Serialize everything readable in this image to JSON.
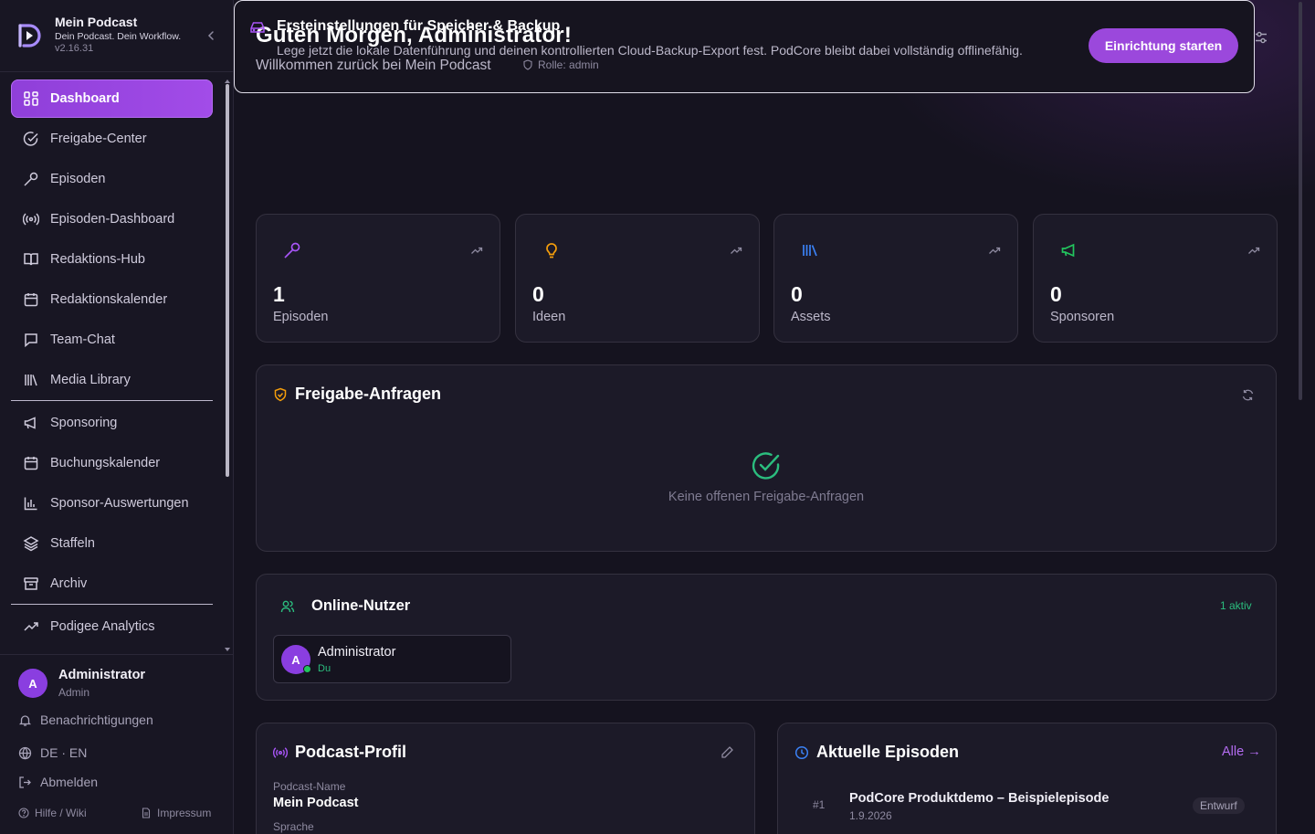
{
  "brand": {
    "name": "Mein Podcast",
    "tagline": "Dein Podcast. Dein Workflow.",
    "version": "v2.16.31"
  },
  "nav": {
    "items": [
      {
        "label": "Dashboard",
        "icon": "grid-icon",
        "active": true
      },
      {
        "label": "Freigabe-Center",
        "icon": "check-circle-icon"
      },
      {
        "label": "Episoden",
        "icon": "microphone-icon"
      },
      {
        "label": "Episoden-Dashboard",
        "icon": "broadcast-icon"
      },
      {
        "label": "Redaktions-Hub",
        "icon": "book-icon"
      },
      {
        "label": "Redaktionskalender",
        "icon": "calendar-icon"
      },
      {
        "label": "Team-Chat",
        "icon": "chat-icon"
      },
      {
        "label": "Media Library",
        "icon": "library-icon"
      },
      {
        "label": "Sponsoring",
        "icon": "megaphone-icon"
      },
      {
        "label": "Buchungskalender",
        "icon": "calendar-icon"
      },
      {
        "label": "Sponsor-Auswertungen",
        "icon": "bar-chart-icon"
      },
      {
        "label": "Staffeln",
        "icon": "layers-icon"
      },
      {
        "label": "Archiv",
        "icon": "archive-icon"
      },
      {
        "label": "Podigee Analytics",
        "icon": "trend-icon"
      }
    ]
  },
  "user": {
    "initial": "A",
    "name": "Administrator",
    "role": "Admin"
  },
  "footer": {
    "notifications": "Benachrichtigungen",
    "language": "DE · EN",
    "logout": "Abmelden",
    "help": "Hilfe / Wiki",
    "imprint": "Impressum"
  },
  "header": {
    "title": "Guten Morgen, Administrator!",
    "subtitle": "Willkommen zurück bei Mein Podcast",
    "role_badge": "Rolle: admin"
  },
  "setup": {
    "title": "Ersteinstellungen für Speicher & Backup",
    "description": "Lege jetzt die lokale Datenführung und deinen kontrollierten Cloud-Backup-Export fest. PodCore bleibt dabei vollständig offlinefähig.",
    "button": "Einrichtung starten"
  },
  "stats": [
    {
      "value": "1",
      "label": "Episoden",
      "icon": "microphone-icon",
      "color": "#a855f7"
    },
    {
      "value": "0",
      "label": "Ideen",
      "icon": "lightbulb-icon",
      "color": "#f59e0b"
    },
    {
      "value": "0",
      "label": "Assets",
      "icon": "library-icon",
      "color": "#3b82f6"
    },
    {
      "value": "0",
      "label": "Sponsoren",
      "icon": "megaphone-icon",
      "color": "#22c55e"
    }
  ],
  "approvals": {
    "title": "Freigabe-Anfragen",
    "empty": "Keine offenen Freigabe-Anfragen"
  },
  "online": {
    "title": "Online-Nutzer",
    "count": "1 aktiv",
    "user": {
      "initial": "A",
      "name": "Administrator",
      "sub": "Du"
    }
  },
  "profile": {
    "title": "Podcast-Profil",
    "name_label": "Podcast-Name",
    "name_value": "Mein Podcast",
    "lang_label": "Sprache"
  },
  "episodes": {
    "title": "Aktuelle Episoden",
    "all_link": "Alle →",
    "items": [
      {
        "number": "#1",
        "title": "PodCore Produktdemo – Beispielepisode",
        "date": "1.9.2026",
        "status": "Entwurf"
      }
    ]
  },
  "colors": {
    "accent": "#9b48dc",
    "success": "#2bbd7e",
    "warning": "#f59e0b",
    "info": "#3b82f6"
  }
}
